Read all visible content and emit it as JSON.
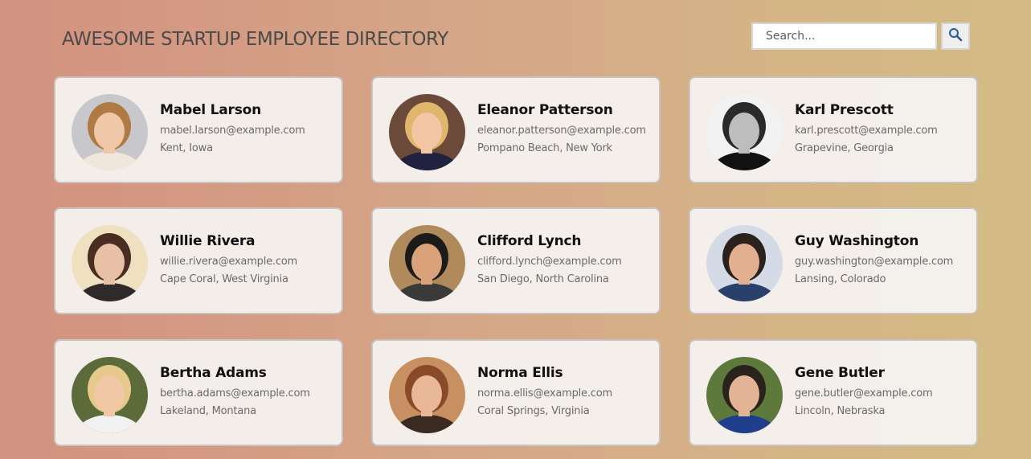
{
  "header": {
    "title": "AWESOME STARTUP EMPLOYEE DIRECTORY"
  },
  "search": {
    "placeholder": "Search...",
    "button_icon": "search-icon"
  },
  "employees": [
    {
      "name": "Mabel Larson",
      "email": "mabel.larson@example.com",
      "location": "Kent, Iowa",
      "skin": "#f0c8a8",
      "hair": "#b07a45",
      "bg": "#c8c8cc",
      "shirt": "#efe6dc"
    },
    {
      "name": "Eleanor Patterson",
      "email": "eleanor.patterson@example.com",
      "location": "Pompano Beach, New York",
      "skin": "#f2c6a2",
      "hair": "#e0b66a",
      "bg": "#6b4a3a",
      "shirt": "#1f2340"
    },
    {
      "name": "Karl Prescott",
      "email": "karl.prescott@example.com",
      "location": "Grapevine, Georgia",
      "skin": "#bdbdbd",
      "hair": "#2a2a2a",
      "bg": "#f2f2f2",
      "shirt": "#111111"
    },
    {
      "name": "Willie Rivera",
      "email": "willie.rivera@example.com",
      "location": "Cape Coral, West Virginia",
      "skin": "#e8c0a6",
      "hair": "#4a2c22",
      "bg": "#efe0c0",
      "shirt": "#2e2a2a"
    },
    {
      "name": "Clifford Lynch",
      "email": "clifford.lynch@example.com",
      "location": "San Diego, North Carolina",
      "skin": "#d9a27a",
      "hair": "#1c1a1a",
      "bg": "#b08a5a",
      "shirt": "#3a3a3a"
    },
    {
      "name": "Guy Washington",
      "email": "guy.washington@example.com",
      "location": "Lansing, Colorado",
      "skin": "#e3b08f",
      "hair": "#2b221e",
      "bg": "#d5dbe6",
      "shirt": "#29406a"
    },
    {
      "name": "Bertha Adams",
      "email": "bertha.adams@example.com",
      "location": "Lakeland, Montana",
      "skin": "#f0c8a6",
      "hair": "#e7c98c",
      "bg": "#5b6b3a",
      "shirt": "#f2f2f2"
    },
    {
      "name": "Norma Ellis",
      "email": "norma.ellis@example.com",
      "location": "Coral Springs, Virginia",
      "skin": "#e8b898",
      "hair": "#8a4a2a",
      "bg": "#c89060",
      "shirt": "#3a2a22"
    },
    {
      "name": "Gene Butler",
      "email": "gene.butler@example.com",
      "location": "Lincoln, Nebraska",
      "skin": "#e2b495",
      "hair": "#2a221c",
      "bg": "#5d7a3c",
      "shirt": "#1f3e8c"
    }
  ]
}
